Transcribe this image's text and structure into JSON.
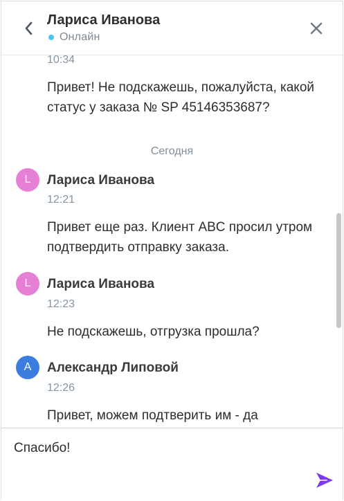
{
  "header": {
    "contact_name": "Лариса Иванова",
    "status": "Онлайн",
    "status_color": "#48c5f0"
  },
  "messages": {
    "first": {
      "time": "10:34",
      "text": "Привет! Не подскажешь, пожалуйста, какой статус у заказа № SP 45146353687?"
    },
    "day_divider": "Сегодня",
    "items": [
      {
        "avatar_letter": "L",
        "avatar_color": "#e67fd6",
        "sender": "Лариса Иванова",
        "time": "12:21",
        "text": "Привет еще раз. Клиент ABC просил утром подтвердить отправку заказа."
      },
      {
        "avatar_letter": "L",
        "avatar_color": "#e67fd6",
        "sender": "Лариса Иванова",
        "time": "12:23",
        "text": "Не подскажешь, отгрузка прошла?"
      },
      {
        "avatar_letter": "A",
        "avatar_color": "#3d7de0",
        "sender": "Александр Липовой",
        "time": "12:26",
        "text": "Привет, можем подтверить им - да"
      }
    ]
  },
  "composer": {
    "value": "Спасибо!",
    "send_icon_color": "#7c3aed"
  },
  "icons": {
    "back": "chevron-left-icon",
    "close": "close-icon",
    "send": "send-icon"
  }
}
